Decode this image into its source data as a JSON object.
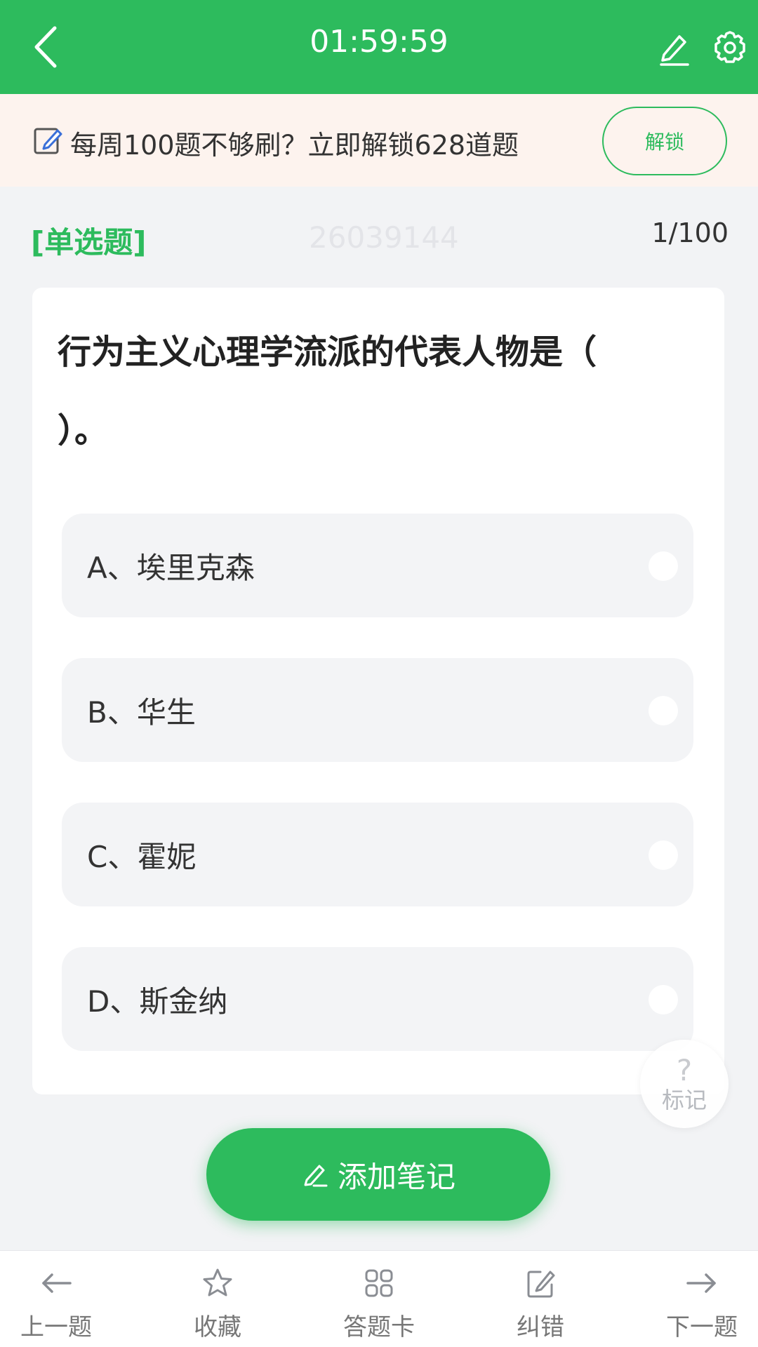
{
  "header": {
    "timer": "01:59:59",
    "back_icon": "chevron-left-icon",
    "edit_icon": "pencil-icon",
    "settings_icon": "gear-icon",
    "color": "#2dbb5d"
  },
  "promo": {
    "text": "每周100题不够刷？立即解锁628道题",
    "unlock_label": "解锁",
    "icon": "edit-note-icon"
  },
  "question_meta": {
    "type": "[单选题]",
    "watermark": "26039144",
    "progress": "1/100"
  },
  "question": {
    "text": "行为主义心理学流派的代表人物是（ ）。",
    "options": [
      {
        "label": "A、埃里克森",
        "selected": false
      },
      {
        "label": "B、华生",
        "selected": false
      },
      {
        "label": "C、霍妮",
        "selected": false
      },
      {
        "label": "D、斯金纳",
        "selected": false
      }
    ]
  },
  "mark": {
    "symbol": "?",
    "label": "标记"
  },
  "note_button": {
    "label": "添加笔记",
    "icon": "pen-icon"
  },
  "bottom_nav": [
    {
      "label": "上一题",
      "icon": "arrow-left-icon"
    },
    {
      "label": "收藏",
      "icon": "star-icon"
    },
    {
      "label": "答题卡",
      "icon": "grid-icon"
    },
    {
      "label": "纠错",
      "icon": "edit-icon"
    },
    {
      "label": "下一题",
      "icon": "arrow-right-icon"
    }
  ]
}
